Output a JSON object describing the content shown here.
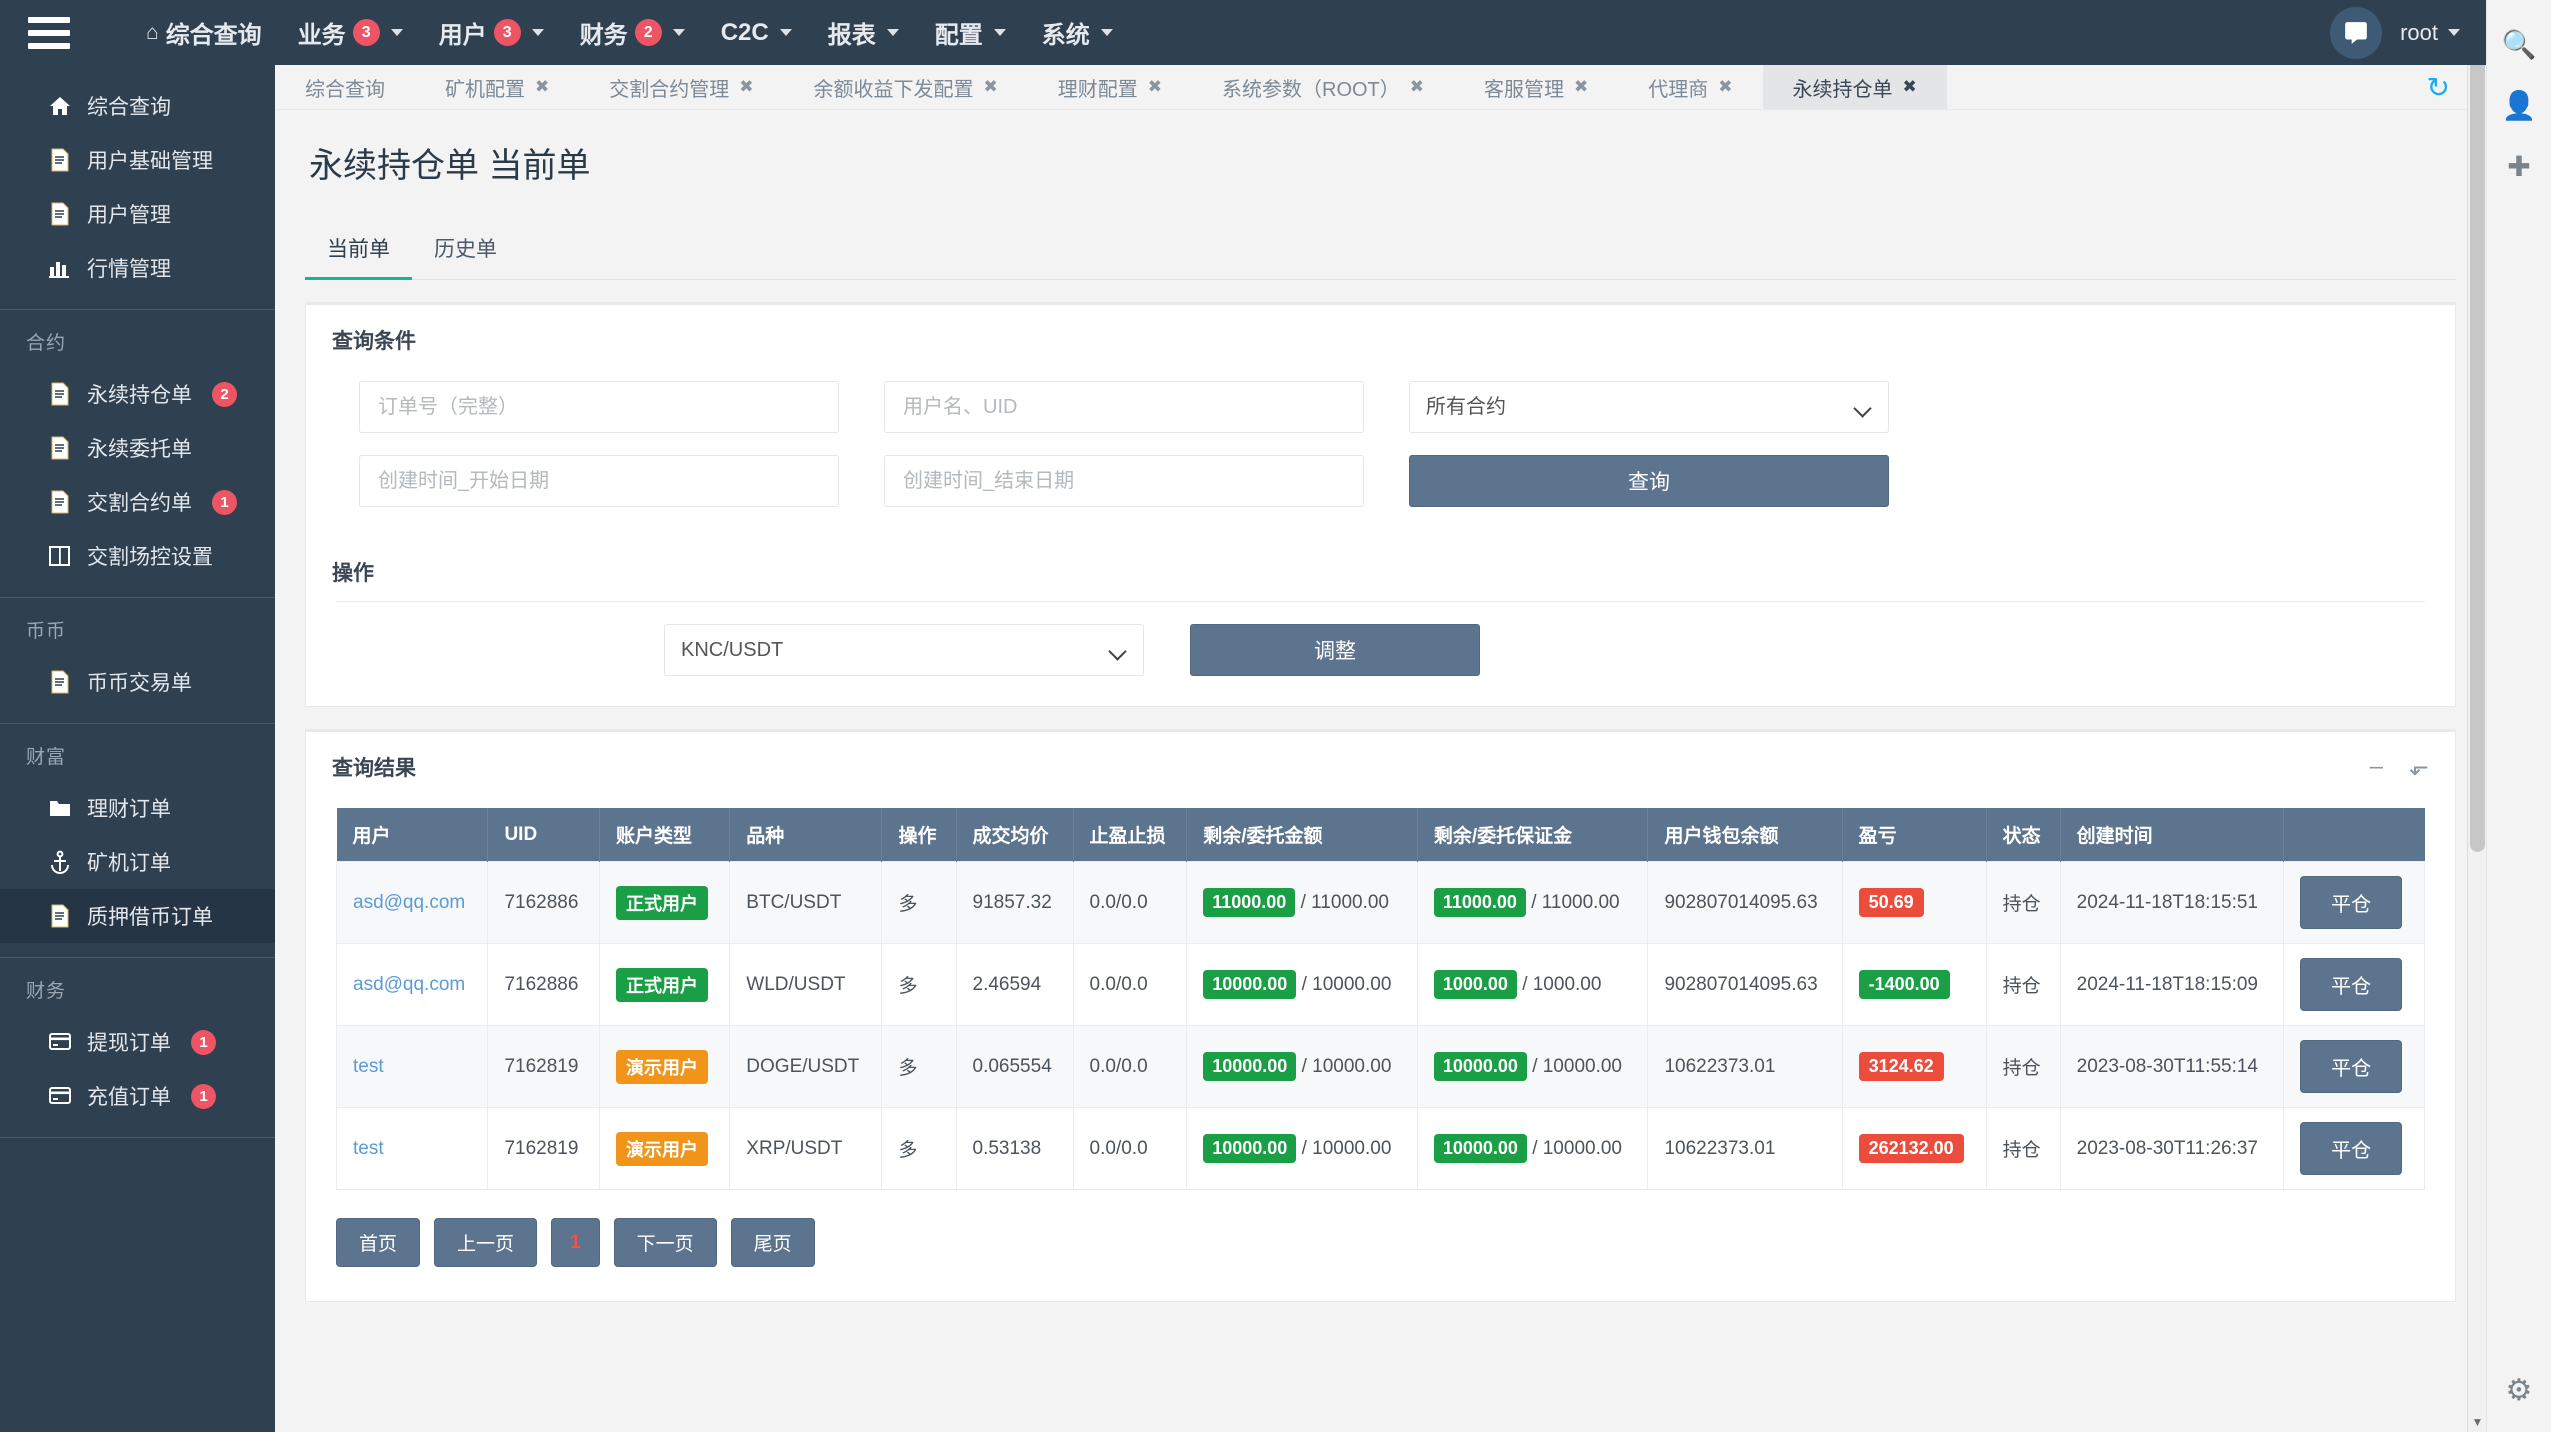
{
  "topnav": {
    "hamburger": "menu-icon",
    "items": [
      {
        "label": "综合查询",
        "icon": "home-icon",
        "badge": null,
        "caret": false
      },
      {
        "label": "业务",
        "icon": null,
        "badge": "3",
        "caret": true
      },
      {
        "label": "用户",
        "icon": null,
        "badge": "3",
        "caret": true
      },
      {
        "label": "财务",
        "icon": null,
        "badge": "2",
        "caret": true
      },
      {
        "label": "C2C",
        "icon": null,
        "badge": null,
        "caret": true
      },
      {
        "label": "报表",
        "icon": null,
        "badge": null,
        "caret": true
      },
      {
        "label": "配置",
        "icon": null,
        "badge": null,
        "caret": true
      },
      {
        "label": "系统",
        "icon": null,
        "badge": null,
        "caret": true
      }
    ],
    "user": "root"
  },
  "sidebar": {
    "groups": [
      {
        "header": null,
        "items": [
          {
            "label": "综合查询",
            "icon": "home-icon",
            "badge": null,
            "active": false
          },
          {
            "label": "用户基础管理",
            "icon": "file-icon",
            "badge": null,
            "active": false
          },
          {
            "label": "用户管理",
            "icon": "file-icon",
            "badge": null,
            "active": false
          },
          {
            "label": "行情管理",
            "icon": "chart-bar-icon",
            "badge": null,
            "active": false
          }
        ]
      },
      {
        "header": "合约",
        "items": [
          {
            "label": "永续持仓单",
            "icon": "file-icon",
            "badge": "2",
            "active": false
          },
          {
            "label": "永续委托单",
            "icon": "file-icon",
            "badge": null,
            "active": false
          },
          {
            "label": "交割合约单",
            "icon": "file-icon",
            "badge": "1",
            "active": false
          },
          {
            "label": "交割场控设置",
            "icon": "columns-icon",
            "badge": null,
            "active": false
          }
        ]
      },
      {
        "header": "币币",
        "items": [
          {
            "label": "币币交易单",
            "icon": "file-icon",
            "badge": null,
            "active": false
          }
        ]
      },
      {
        "header": "财富",
        "items": [
          {
            "label": "理财订单",
            "icon": "folder-icon",
            "badge": null,
            "active": false
          },
          {
            "label": "矿机订单",
            "icon": "anchor-icon",
            "badge": null,
            "active": false
          },
          {
            "label": "质押借币订单",
            "icon": "file-icon",
            "badge": null,
            "active": true
          }
        ]
      },
      {
        "header": "财务",
        "items": [
          {
            "label": "提现订单",
            "icon": "credit-card-icon",
            "badge": "1",
            "active": false
          },
          {
            "label": "充值订单",
            "icon": "credit-card-icon",
            "badge": "1",
            "active": false
          }
        ]
      }
    ]
  },
  "tabs": [
    {
      "label": "综合查询",
      "closable": false,
      "active": false
    },
    {
      "label": "矿机配置",
      "closable": true,
      "active": false
    },
    {
      "label": "交割合约管理",
      "closable": true,
      "active": false
    },
    {
      "label": "余额收益下发配置",
      "closable": true,
      "active": false
    },
    {
      "label": "理财配置",
      "closable": true,
      "active": false
    },
    {
      "label": "系统参数（ROOT）",
      "closable": true,
      "active": false
    },
    {
      "label": "客服管理",
      "closable": true,
      "active": false
    },
    {
      "label": "代理商",
      "closable": true,
      "active": false
    },
    {
      "label": "永续持仓单",
      "closable": true,
      "active": true
    }
  ],
  "page": {
    "title": "永续持仓单 当前单",
    "subtabs": [
      {
        "label": "当前单",
        "active": true
      },
      {
        "label": "历史单",
        "active": false
      }
    ]
  },
  "query_panel": {
    "label": "查询条件",
    "order_no_placeholder": "订单号（完整）",
    "user_placeholder": "用户名、UID",
    "contract_selected": "所有合约",
    "start_date_placeholder": "创建时间_开始日期",
    "end_date_placeholder": "创建时间_结束日期",
    "search_button": "查询"
  },
  "operation_panel": {
    "label": "操作",
    "symbol_selected": "KNC/USDT",
    "adjust_button": "调整"
  },
  "results": {
    "label": "查询结果",
    "minimize_icon": "minus-icon",
    "expand_icon": "expand-icon",
    "columns": [
      "用户",
      "UID",
      "账户类型",
      "品种",
      "操作",
      "成交均价",
      "止盈止损",
      "剩余/委托金额",
      "剩余/委托保证金",
      "用户钱包余额",
      "盈亏",
      "状态",
      "创建时间",
      ""
    ],
    "rows": [
      {
        "user": "asd@qq.com",
        "uid": "7162886",
        "account_type": "正式用户",
        "account_type_color": "green",
        "symbol": "BTC/USDT",
        "direction": "多",
        "avg_price": "91857.32",
        "tp_sl": "0.0/0.0",
        "amount_badge": "11000.00",
        "amount_rest": "/ 11000.00",
        "margin_badge": "11000.00",
        "margin_rest": "/ 11000.00",
        "wallet": "902807014095.63",
        "pnl": "50.69",
        "pnl_color": "red",
        "status": "持仓",
        "created": "2024-11-18T18:15:51",
        "action": "平仓"
      },
      {
        "user": "asd@qq.com",
        "uid": "7162886",
        "account_type": "正式用户",
        "account_type_color": "green",
        "symbol": "WLD/USDT",
        "direction": "多",
        "avg_price": "2.46594",
        "tp_sl": "0.0/0.0",
        "amount_badge": "10000.00",
        "amount_rest": "/ 10000.00",
        "margin_badge": "1000.00",
        "margin_rest": "/ 1000.00",
        "wallet": "902807014095.63",
        "pnl": "-1400.00",
        "pnl_color": "green",
        "status": "持仓",
        "created": "2024-11-18T18:15:09",
        "action": "平仓"
      },
      {
        "user": "test",
        "uid": "7162819",
        "account_type": "演示用户",
        "account_type_color": "orange",
        "symbol": "DOGE/USDT",
        "direction": "多",
        "avg_price": "0.065554",
        "tp_sl": "0.0/0.0",
        "amount_badge": "10000.00",
        "amount_rest": "/ 10000.00",
        "margin_badge": "10000.00",
        "margin_rest": "/ 10000.00",
        "wallet": "10622373.01",
        "pnl": "3124.62",
        "pnl_color": "red",
        "status": "持仓",
        "created": "2023-08-30T11:55:14",
        "action": "平仓"
      },
      {
        "user": "test",
        "uid": "7162819",
        "account_type": "演示用户",
        "account_type_color": "orange",
        "symbol": "XRP/USDT",
        "direction": "多",
        "avg_price": "0.53138",
        "tp_sl": "0.0/0.0",
        "amount_badge": "10000.00",
        "amount_rest": "/ 10000.00",
        "margin_badge": "10000.00",
        "margin_rest": "/ 10000.00",
        "wallet": "10622373.01",
        "pnl": "262132.00",
        "pnl_color": "red",
        "status": "持仓",
        "created": "2023-08-30T11:26:37",
        "action": "平仓"
      }
    ],
    "pagination": {
      "first": "首页",
      "prev": "上一页",
      "current": "1",
      "next": "下一页",
      "last": "尾页"
    }
  },
  "colors": {
    "nav_bg": "#2f4050",
    "accent_blue": "#5c748e",
    "badge_red": "#ed5565",
    "tag_green": "#1a9e46",
    "tag_orange": "#f0951a",
    "tag_red": "#ec4c3c",
    "link_blue": "#5b9bd5",
    "tab_active_underline": "#1ab394"
  }
}
